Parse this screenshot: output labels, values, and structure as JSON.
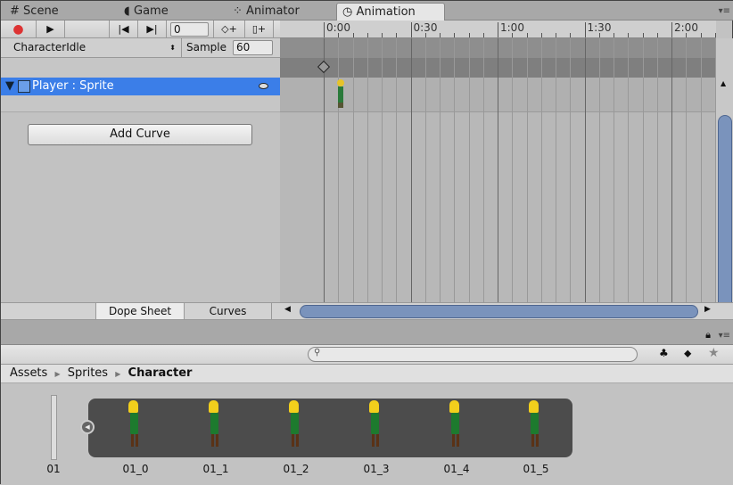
{
  "tabs": [
    {
      "label": "Scene",
      "icon": "hash-icon"
    },
    {
      "label": "Game",
      "icon": "pacman-icon"
    },
    {
      "label": "Animator",
      "icon": "animator-icon"
    },
    {
      "label": "Animation",
      "icon": "clock-icon",
      "active": true
    }
  ],
  "toolbar": {
    "frame": "0"
  },
  "clip": {
    "name": "CharacterIdle",
    "sample_label": "Sample",
    "sample": "60"
  },
  "property": {
    "label": "Player : Sprite"
  },
  "add_curve": "Add Curve",
  "ruler": {
    "labels": [
      "0:00",
      "0:30",
      "1:00",
      "1:30",
      "2:00"
    ]
  },
  "bottom_tabs": {
    "dope": "Dope Sheet",
    "curves": "Curves"
  },
  "project": {
    "search_placeholder": "",
    "breadcrumb": [
      "Assets",
      "Sprites",
      "Character"
    ],
    "assets": [
      "01",
      "01_0",
      "01_1",
      "01_2",
      "01_3",
      "01_4",
      "01_5"
    ]
  },
  "colors": {
    "selection": "#3b7ee8",
    "scroll_thumb": "#7a93bc"
  }
}
